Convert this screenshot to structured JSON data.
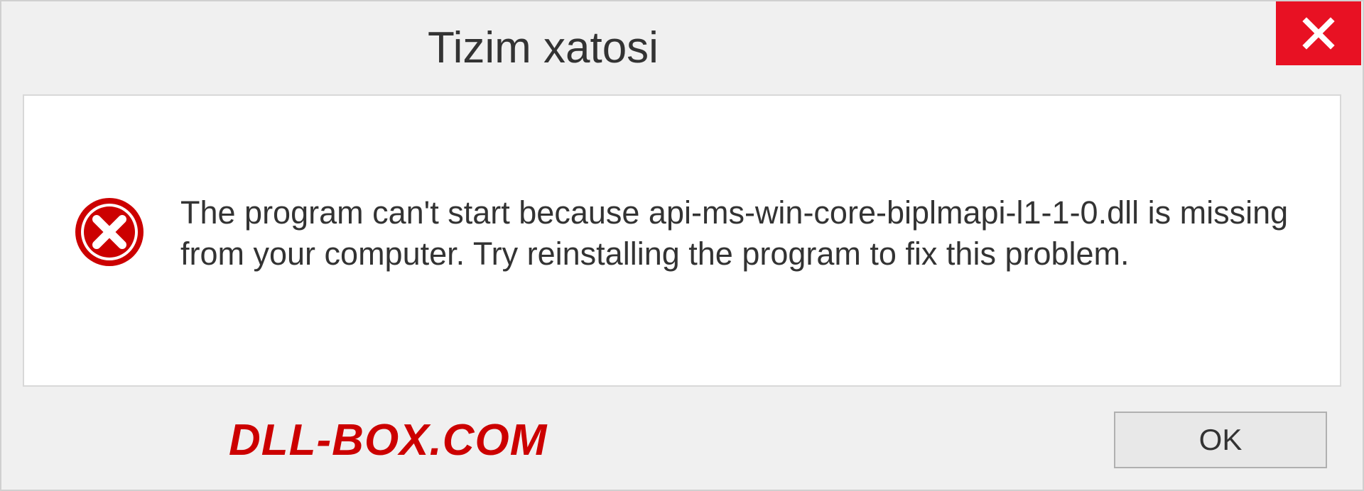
{
  "dialog": {
    "title": "Tizim xatosi",
    "message": "The program can't start because api-ms-win-core-biplmapi-l1-1-0.dll is missing from your computer. Try reinstalling the program to fix this problem.",
    "ok_label": "OK"
  },
  "watermark": "DLL-BOX.COM"
}
